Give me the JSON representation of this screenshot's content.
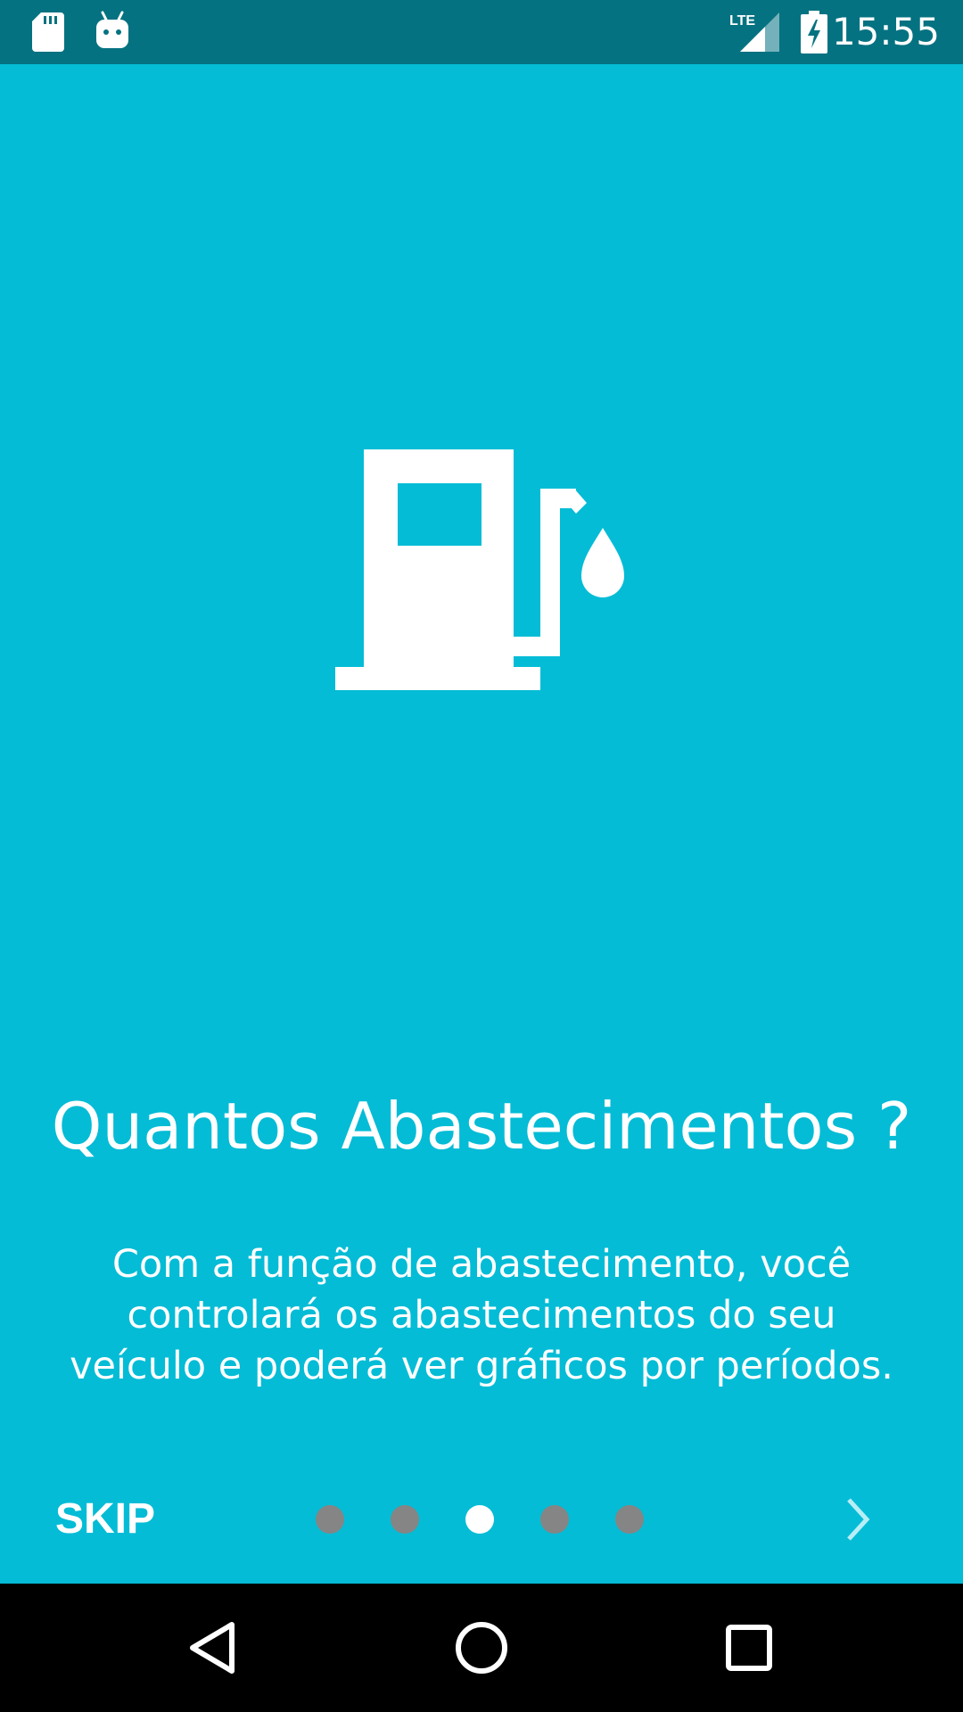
{
  "status_bar": {
    "time": "15:55",
    "network_label": "LTE",
    "icons": [
      "sd-card-icon",
      "android-debug-icon",
      "lte-signal-icon",
      "battery-charging-icon"
    ]
  },
  "intro_slide": {
    "icon": "fuel-pump-icon",
    "title": "Quantos Abastecimentos ?",
    "description": "Com a função de abastecimento, você controlará os abastecimentos do seu veículo e poderá ver gráficos por períodos."
  },
  "bottom_bar": {
    "skip_label": "SKIP",
    "page_count": 5,
    "current_page": 3,
    "next_icon": "chevron-right-icon"
  },
  "nav_bar": {
    "icons": [
      "back-icon",
      "home-icon",
      "recents-icon"
    ]
  },
  "colors": {
    "background": "#04BCD6",
    "status_bar": "#057281",
    "dot_inactive": "#858585",
    "dot_active": "#FFFFFF"
  }
}
